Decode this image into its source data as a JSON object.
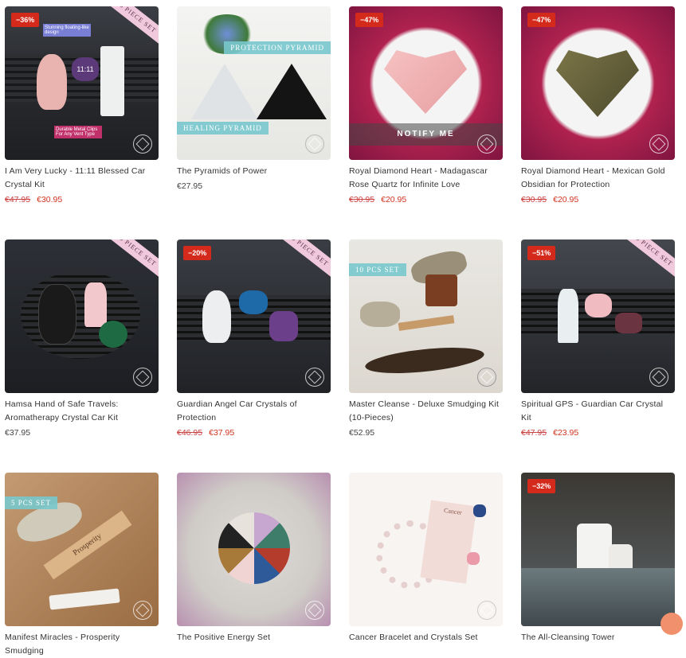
{
  "products": [
    {
      "name": "I Am Very Lucky - 11:11 Blessed Car Crystal Kit",
      "old_price": "€47.95",
      "price": "€30.95",
      "badge": "−36%",
      "ribbon": "3 PIECE SET",
      "note1": "Stunning floating-like design",
      "note2": "Durable Metal Clips For Any Vent Type",
      "sticker": "11:11"
    },
    {
      "name": "The Pyramids of Power",
      "old_price": "",
      "price": "€27.95",
      "badge": "",
      "tag1": "PROTECTION PYRAMID",
      "tag2": "HEALING PYRAMID"
    },
    {
      "name": "Royal Diamond Heart - Madagascar Rose Quartz for Infinite Love",
      "old_price": "€30.95",
      "price": "€20.95",
      "badge": "−47%",
      "notify": "NOTIFY ME"
    },
    {
      "name": "Royal Diamond Heart - Mexican Gold Obsidian for Protection",
      "old_price": "€30.95",
      "price": "€20.95",
      "badge": "−47%"
    },
    {
      "name": "Hamsa Hand of Safe Travels: Aromatherapy Crystal Car Kit",
      "old_price": "",
      "price": "€37.95",
      "badge": "",
      "ribbon": "3 PIECE SET"
    },
    {
      "name": "Guardian Angel Car Crystals of Protection",
      "old_price": "€46.95",
      "price": "€37.95",
      "badge": "−20%",
      "ribbon": "3 PIECE SET"
    },
    {
      "name": "Master Cleanse - Deluxe Smudging Kit (10-Pieces)",
      "old_price": "",
      "price": "€52.95",
      "badge": "",
      "tag1": "10 PCS SET"
    },
    {
      "name": "Spiritual GPS - Guardian Car Crystal Kit",
      "old_price": "€47.95",
      "price": "€23.95",
      "badge": "−51%",
      "ribbon": "3 PIECE SET"
    },
    {
      "name": "Manifest Miracles - Prosperity Smudging",
      "old_price": "",
      "price": "",
      "badge": "",
      "tag1": "5 PCS SET",
      "stick": "Prosperity"
    },
    {
      "name": "The Positive Energy Set",
      "old_price": "",
      "price": "",
      "badge": ""
    },
    {
      "name": "Cancer Bracelet and Crystals Set",
      "old_price": "",
      "price": "",
      "badge": "",
      "card_text": "Cancer"
    },
    {
      "name": "The All-Cleansing Tower",
      "old_price": "",
      "price": "",
      "badge": "−32%"
    }
  ],
  "colors": {
    "sale": "#d42a1c",
    "price_new": "#d0341f",
    "ribbon": "#f1c9dc",
    "chat": "#f1906c"
  }
}
